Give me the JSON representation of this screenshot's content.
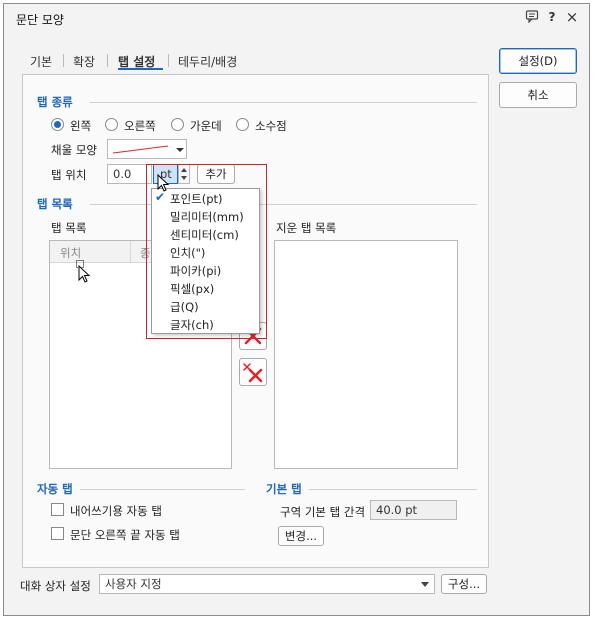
{
  "window": {
    "title": "문단 모양",
    "icons": [
      "dialog-help-icon",
      "question-icon",
      "close-icon"
    ],
    "help_glyph": "?",
    "close_glyph": "×"
  },
  "tabs": [
    {
      "label": "기본",
      "active": false
    },
    {
      "label": "확장",
      "active": false
    },
    {
      "label": "탭 설정",
      "active": true
    },
    {
      "label": "테두리/배경",
      "active": false
    }
  ],
  "buttons": {
    "ok": "설정(D)",
    "cancel": "취소"
  },
  "tab_type": {
    "title": "탭 종류",
    "options": [
      {
        "label": "왼쪽",
        "checked": true
      },
      {
        "label": "오른쪽",
        "checked": false
      },
      {
        "label": "가운데",
        "checked": false
      },
      {
        "label": "소수점",
        "checked": false
      }
    ],
    "fill_label": "채울 모양",
    "position_label": "탭 위치",
    "position_value": "0.0",
    "unit_value": "pt",
    "add_button": "추가"
  },
  "unit_menu": {
    "items": [
      {
        "label": "포인트(pt)",
        "checked": true
      },
      {
        "label": "밀리미터(mm)",
        "checked": false
      },
      {
        "label": "센티미터(cm)",
        "checked": false
      },
      {
        "label": "인치(\")",
        "checked": false
      },
      {
        "label": "파이카(pi)",
        "checked": false
      },
      {
        "label": "픽셀(px)",
        "checked": false
      },
      {
        "label": "급(Q)",
        "checked": false
      },
      {
        "label": "글자(ch)",
        "checked": false
      }
    ],
    "check_glyph": "✔"
  },
  "tab_list": {
    "title": "탭 목록",
    "list_label": "탭 목록",
    "columns": [
      "위치",
      "종"
    ],
    "deleted_label": "지운 탭 목록"
  },
  "auto_tab": {
    "title": "자동 탭",
    "options": [
      {
        "label": "내어쓰기용 자동 탭",
        "checked": false
      },
      {
        "label": "문단 오른쪽 끝 자동 탭",
        "checked": false
      }
    ]
  },
  "default_tab": {
    "title": "기본 탭",
    "spacing_label": "구역 기본 탭 간격",
    "spacing_value": "40.0 pt",
    "change_button": "변경..."
  },
  "footer": {
    "label": "대화 상자 설정",
    "select_value": "사용자 지정",
    "config_button": "구성..."
  },
  "colors": {
    "accent": "#1f67b8",
    "highlight_box": "#c1272d",
    "delete_x": "#d9262c"
  }
}
